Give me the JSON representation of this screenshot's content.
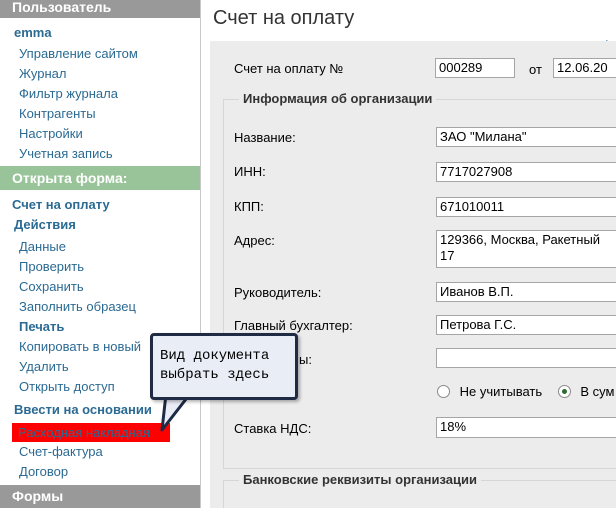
{
  "sidebar": {
    "header_user": "Пользователь",
    "username": "emma",
    "user_links": [
      "Управление сайтом",
      "Журнал",
      "Фильтр журнала",
      "Контрагенты",
      "Настройки",
      "Учетная запись"
    ],
    "open_form_header": "Открыта форма:",
    "open_form_name": "Счет на оплату",
    "actions_title": "Действия",
    "action_links": [
      "Данные",
      "Проверить",
      "Сохранить",
      "Заполнить образец"
    ],
    "print_label": "Печать",
    "print_links": [
      "Копировать в новый",
      "Удалить",
      "Открыть доступ"
    ],
    "based_on_title": "Ввести на основании",
    "based_on_selected": "Расходная накладная",
    "based_on_links": [
      "Счет-фактура",
      "Договор"
    ],
    "forms_header": "Формы"
  },
  "main": {
    "title": "Счет на оплату",
    "plus": "+",
    "invoice_label": "Счет на оплату №",
    "invoice_number": "000289",
    "date_label": "от",
    "date_value": "12.06.20",
    "org_section_title": "Информация об организации",
    "fields": {
      "name_label": "Название:",
      "name_value": "ЗАО \"Милана\"",
      "inn_label": "ИНН:",
      "inn_value": "7717027908",
      "kpp_label": "КПП:",
      "kpp_value": "671010011",
      "address_label": "Адрес:",
      "address_line1": "129366, Москва, Ракетный",
      "address_line2": "17",
      "head_label": "Руководитель:",
      "head_value": "Иванов В.П.",
      "accountant_label": "Главный бухгалтер:",
      "accountant_value": "Петрова Г.С.",
      "hidden_label_tail": "ы:",
      "hidden_value": "",
      "vat_option_off": "Не учитывать",
      "vat_option_on": "В сум",
      "vat_rate_label": "Ставка НДС:",
      "vat_rate_value": "18%"
    },
    "bank_section_title": "Банковские реквизиты организации"
  },
  "callout": {
    "line1": "Вид документа",
    "line2": "выбрать здесь"
  },
  "colors": {
    "sidebar_header": "#999999",
    "sidebar_green": "#99c398",
    "link": "#2b6a93",
    "selected_bg": "#ff0000",
    "panel_bg": "#ececec",
    "callout_bg": "#e9edf5",
    "callout_border": "#1f2a44"
  }
}
